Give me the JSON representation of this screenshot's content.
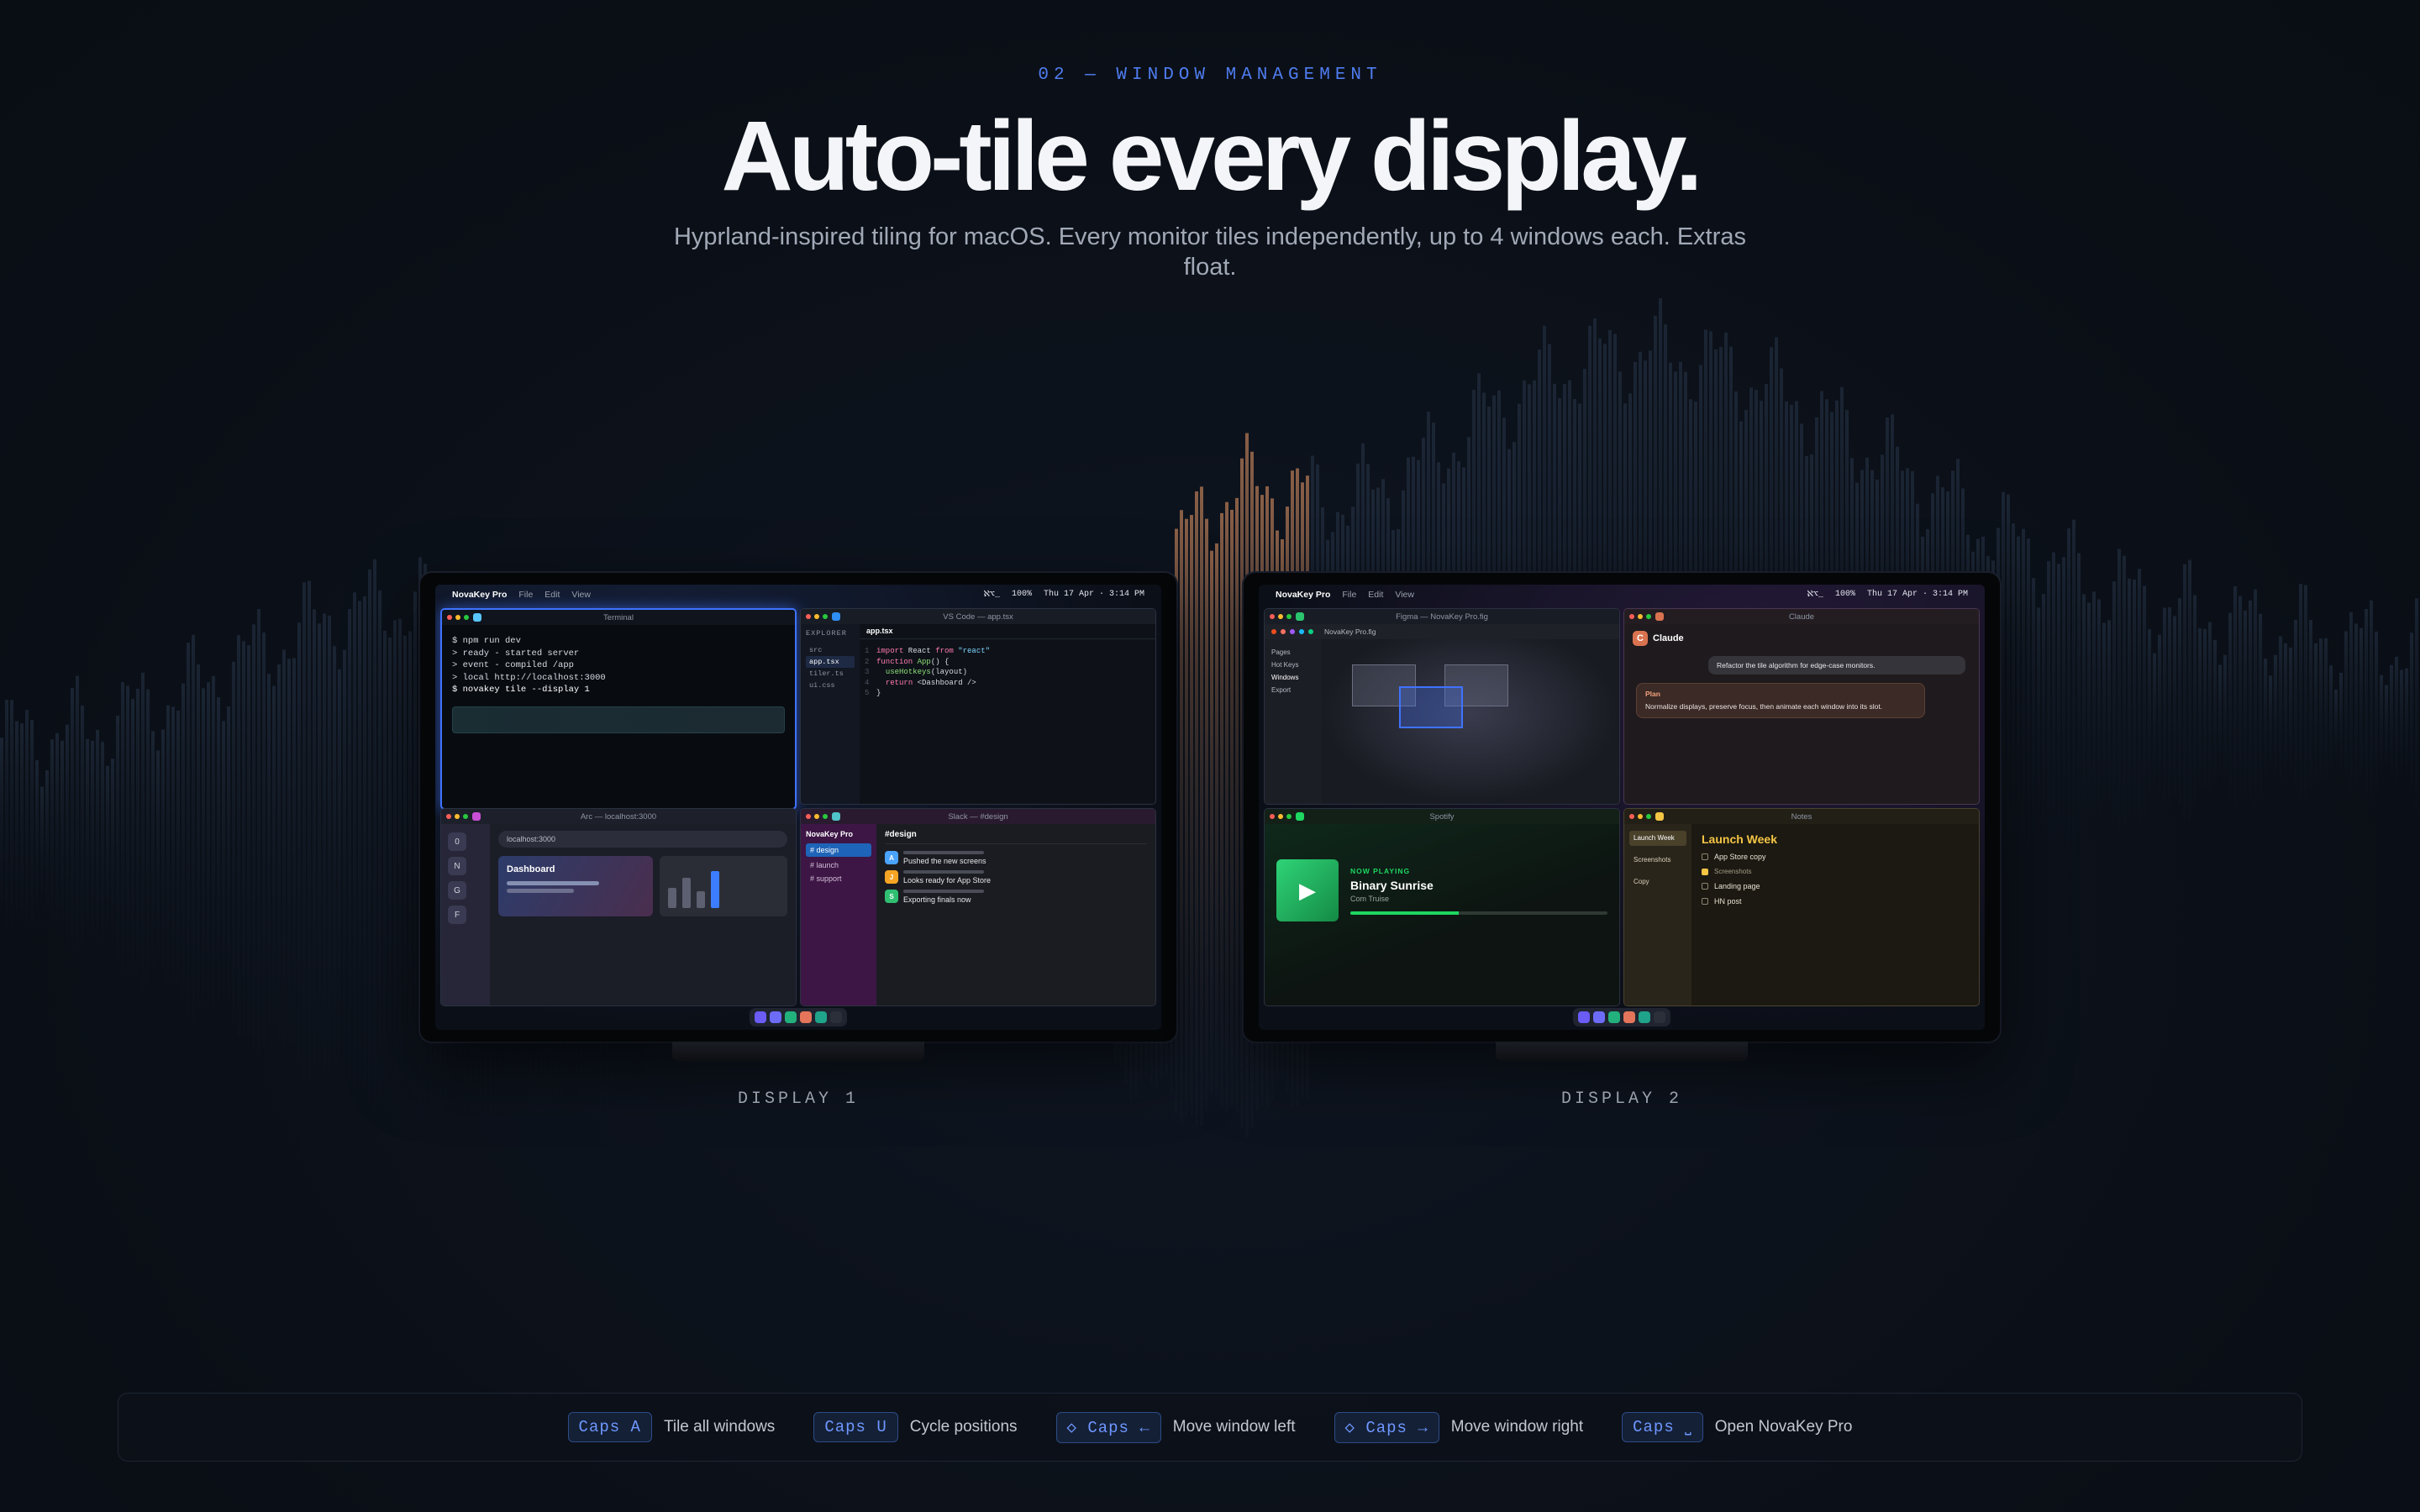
{
  "section_label": "02 — WINDOW MANAGEMENT",
  "headline": "Auto-tile every display.",
  "subheadline": "Hyprland-inspired tiling for macOS. Every monitor tiles independently, up to 4 windows each. Extras float.",
  "colors": {
    "accent": "#4f7cf0",
    "background": "#0b1018",
    "wave_warm": "#c9825a",
    "wave_cool": "#3a4a63"
  },
  "display1": {
    "label": "DISPLAY 1",
    "menubar": {
      "app": "NovaKey Pro",
      "items": [
        "File",
        "Edit",
        "View"
      ],
      "status_icon": "ℵ⌥_",
      "battery": "100%",
      "datetime": "Thu 17 Apr · 3:14 PM"
    },
    "terminal": {
      "title": "Terminal",
      "lines": [
        "$ npm run dev",
        "> ready - started server",
        "> event - compiled /app",
        "> local http://localhost:3000",
        "$ novakey tile --display 1"
      ]
    },
    "vscode": {
      "title": "VS Code — app.tsx",
      "explorer_label": "EXPLORER",
      "files": [
        "src",
        "app.tsx",
        "tiler.ts",
        "ui.css"
      ],
      "active_tab": "app.tsx",
      "code": [
        {
          "n": "1",
          "parts": [
            [
              "kw",
              "import"
            ],
            [
              "tx",
              " React "
            ],
            [
              "kw",
              "from"
            ],
            [
              "st",
              " \"react\""
            ]
          ]
        },
        {
          "n": "2",
          "parts": [
            [
              "kw",
              "function"
            ],
            [
              "fn",
              " App"
            ],
            [
              "tx",
              "() {"
            ]
          ]
        },
        {
          "n": "3",
          "parts": [
            [
              "tx",
              "  "
            ],
            [
              "fn",
              "useHotkeys"
            ],
            [
              "tx",
              "(layout)"
            ]
          ]
        },
        {
          "n": "4",
          "parts": [
            [
              "tx",
              "  "
            ],
            [
              "kw",
              "return"
            ],
            [
              "tx",
              " <Dashboard />"
            ]
          ]
        },
        {
          "n": "5",
          "parts": [
            [
              "tx",
              "}"
            ]
          ]
        }
      ]
    },
    "arc": {
      "title": "Arc — localhost:3000",
      "url": "localhost:3000",
      "sidebar": [
        "0",
        "N",
        "G",
        "F"
      ],
      "card_title": "Dashboard"
    },
    "slack": {
      "title": "Slack — #design",
      "workspace": "NovaKey Pro",
      "channels": [
        "# design",
        "# launch",
        "# support"
      ],
      "channel_header": "#design",
      "messages": [
        {
          "avatar": "A",
          "text": "Pushed the new screens",
          "color": "#4aa3ff"
        },
        {
          "avatar": "J",
          "text": "Looks ready for App Store",
          "color": "#f5a524"
        },
        {
          "avatar": "S",
          "text": "Exporting finals now",
          "color": "#2fbf71"
        }
      ]
    }
  },
  "display2": {
    "label": "DISPLAY 2",
    "menubar": {
      "app": "NovaKey Pro",
      "items": [
        "File",
        "Edit",
        "View"
      ],
      "status_icon": "ℵ⌥_",
      "battery": "100%",
      "datetime": "Thu 17 Apr · 3:14 PM"
    },
    "figma": {
      "title": "Figma — NovaKey Pro.fig",
      "tab": "NovaKey Pro.fig",
      "layers": [
        "Pages",
        "Hot Keys",
        "Windows",
        "Export"
      ]
    },
    "claude": {
      "title": "Claude",
      "name": "Claude",
      "prompt": "Refactor the tile algorithm for edge-case monitors.",
      "plan_label": "Plan",
      "plan_text": "Normalize displays, preserve focus, then animate each window into its slot."
    },
    "spotify": {
      "title": "Spotify",
      "now_playing": "NOW PLAYING",
      "track": "Binary Sunrise",
      "artist": "Com Truise",
      "progress": 0.42
    },
    "notes": {
      "title": "Notes",
      "sidebar": [
        "Launch Week",
        "Screenshots",
        "Copy"
      ],
      "heading": "Launch Week",
      "items": [
        {
          "text": "App Store copy",
          "checked": false
        },
        {
          "text": "Screenshots",
          "checked": true
        },
        {
          "text": "Landing page",
          "checked": false
        },
        {
          "text": "HN post",
          "checked": false
        }
      ]
    }
  },
  "dock_colors": [
    "#6a5cf5",
    "#6c6cf8",
    "#22b07d",
    "#e4745a",
    "#1fa38a",
    "#2a2f3a"
  ],
  "shortcuts": [
    {
      "keys": "Caps A",
      "label": "Tile all windows"
    },
    {
      "keys": "Caps U",
      "label": "Cycle positions"
    },
    {
      "keys": "◇ Caps ←",
      "label": "Move window left"
    },
    {
      "keys": "◇ Caps →",
      "label": "Move window right"
    },
    {
      "keys": "Caps ⎵",
      "label": "Open NovaKey Pro"
    }
  ]
}
